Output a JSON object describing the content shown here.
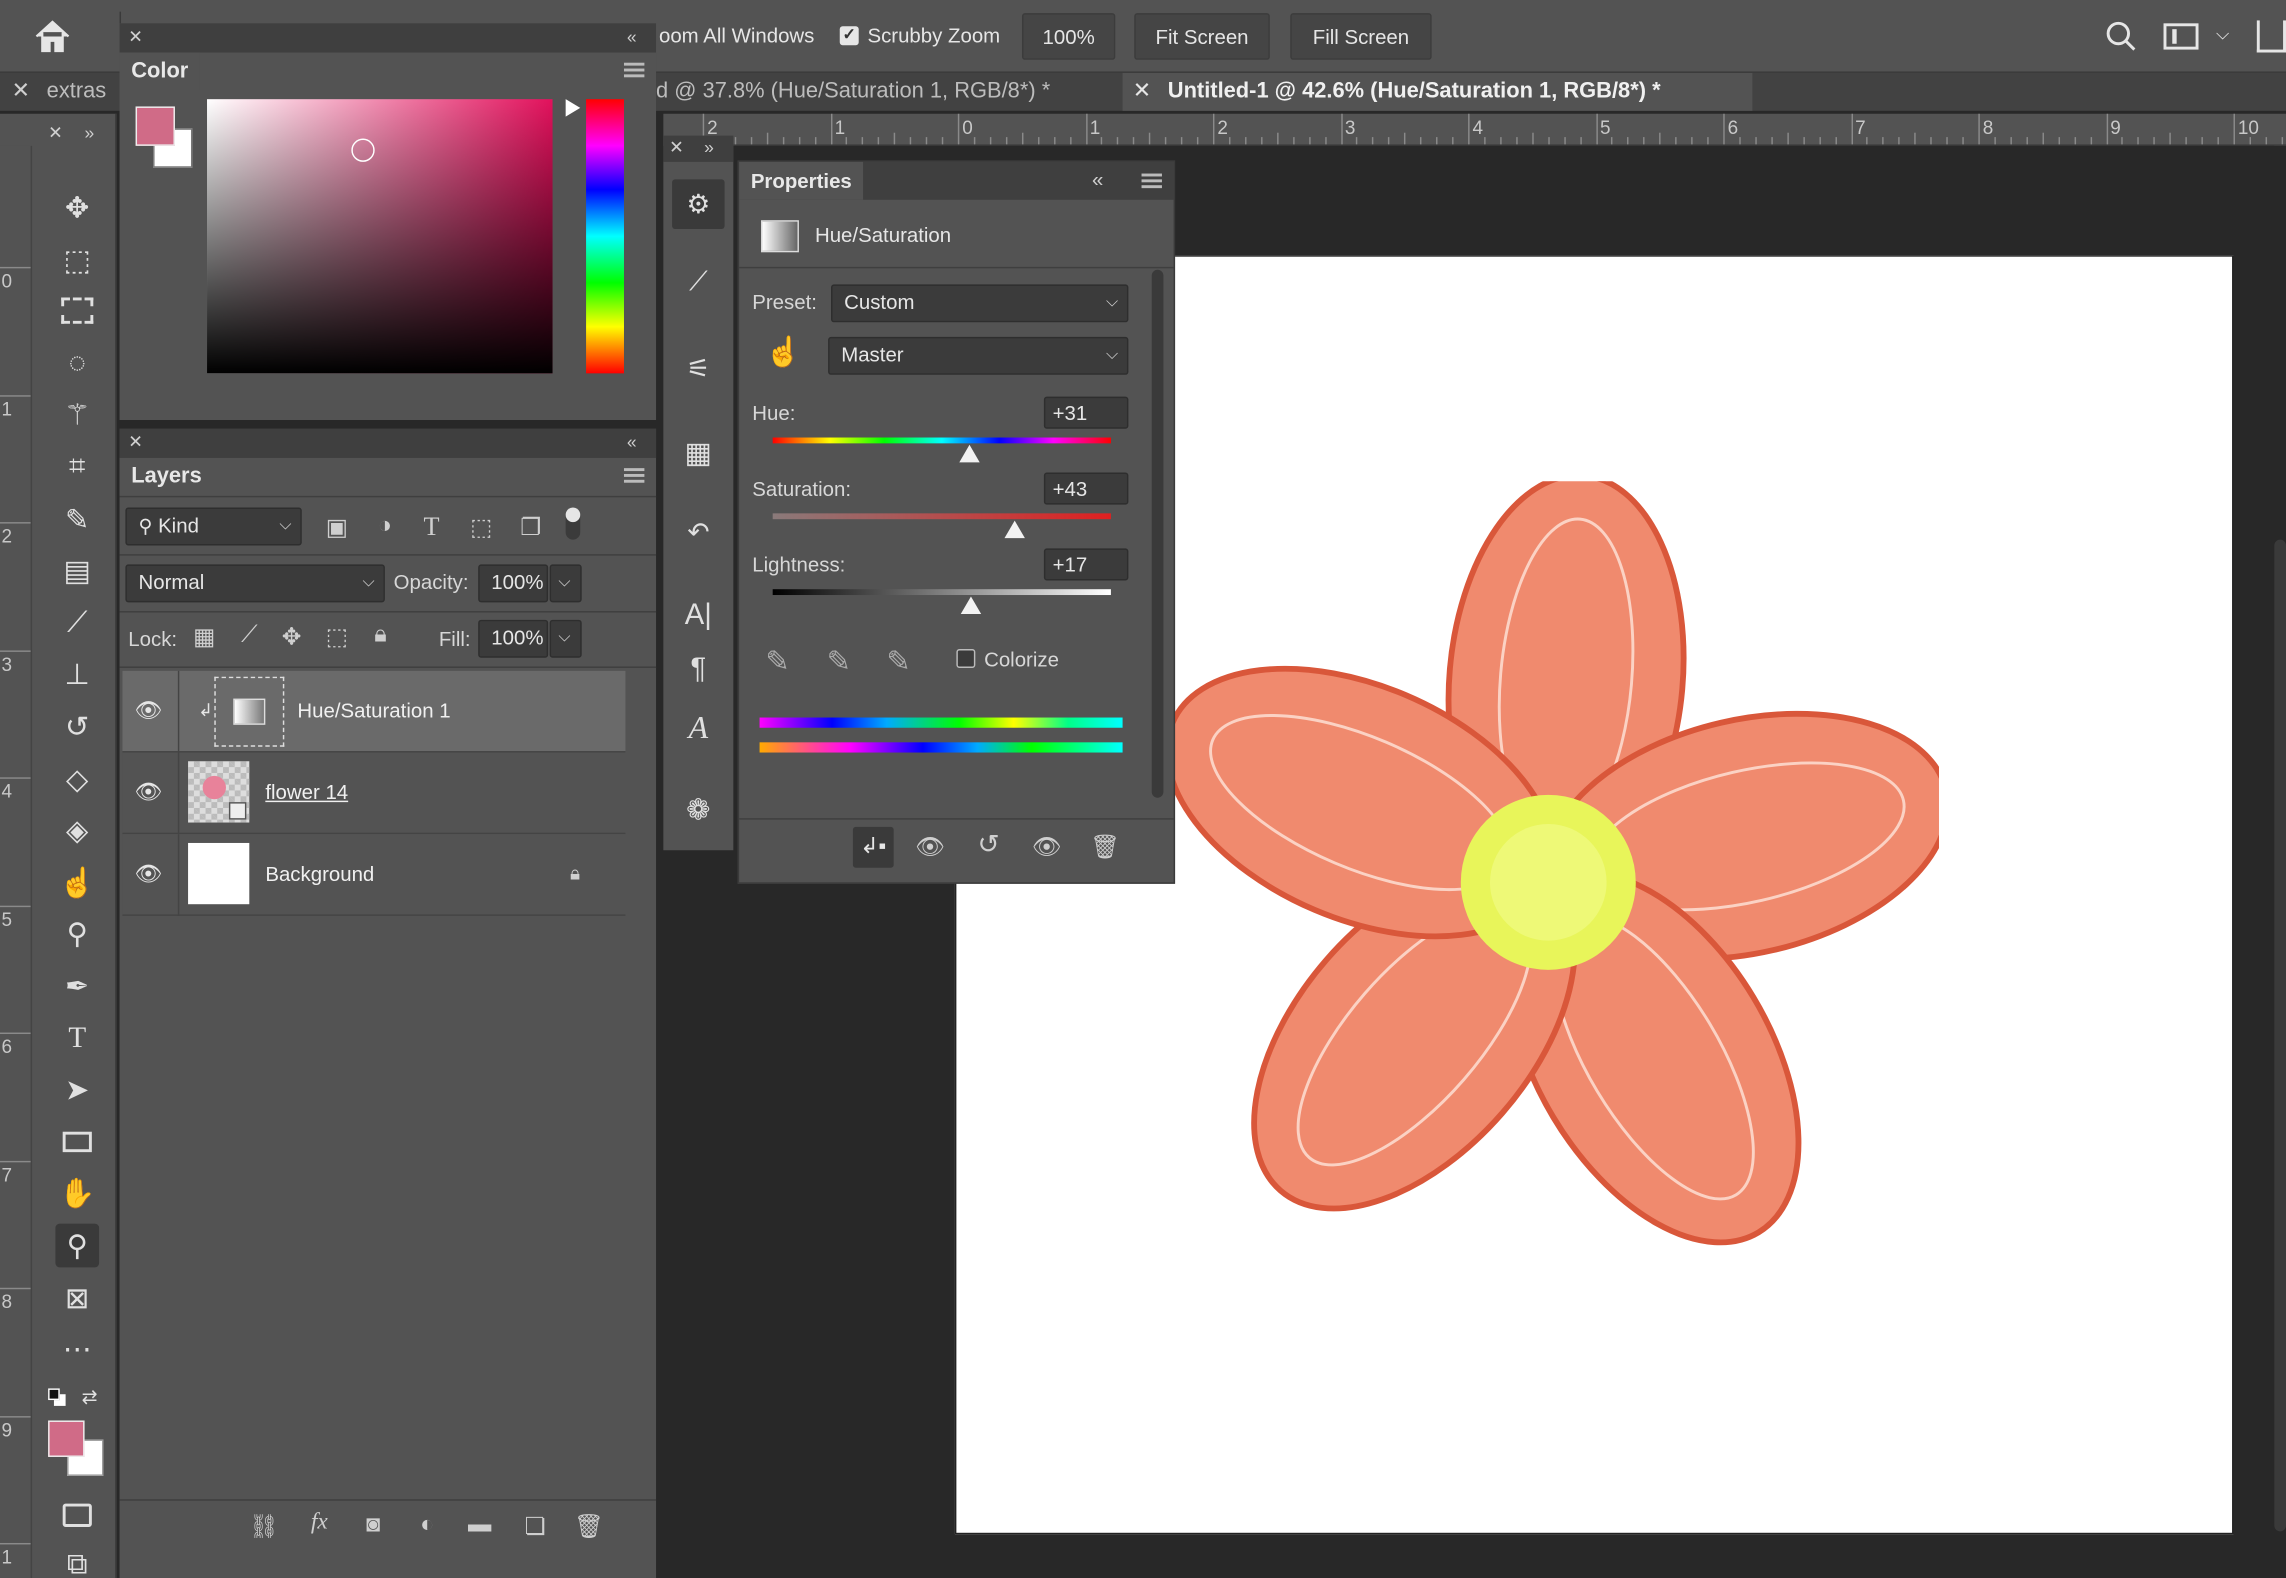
{
  "options_bar": {
    "zoom_all_windows": "oom All Windows",
    "scrubby_zoom": "Scrubby Zoom",
    "zoom_value": "100%",
    "fit_screen": "Fit Screen",
    "fill_screen": "Fill Screen"
  },
  "tabs": {
    "extras": "extras",
    "doc1": "d @ 37.8% (Hue/Saturation 1, RGB/8*) *",
    "doc2": "Untitled-1 @ 42.6% (Hue/Saturation 1, RGB/8*) *"
  },
  "ruler": {
    "top_numbers": [
      "2",
      "1",
      "0",
      "1",
      "2",
      "3",
      "4",
      "5",
      "6",
      "7",
      "8",
      "9",
      "10"
    ],
    "left_numbers": [
      "0",
      "1",
      "2",
      "3",
      "4",
      "5",
      "6",
      "7",
      "8",
      "9",
      "1"
    ]
  },
  "color_panel": {
    "title": "Color",
    "foreground": "#d06b87"
  },
  "layers_panel": {
    "title": "Layers",
    "filter_kind": "Kind",
    "blend_mode": "Normal",
    "opacity_label": "Opacity:",
    "opacity_value": "100%",
    "lock_label": "Lock:",
    "fill_label": "Fill:",
    "fill_value": "100%",
    "layers": [
      {
        "name": "Hue/Saturation 1"
      },
      {
        "name": "flower 14"
      },
      {
        "name": "Background"
      }
    ]
  },
  "properties_panel": {
    "title": "Properties",
    "adjustment_name": "Hue/Saturation",
    "preset_label": "Preset:",
    "preset_value": "Custom",
    "channel_value": "Master",
    "hue_label": "Hue:",
    "hue_value": "+31",
    "hue_level": 0.58,
    "saturation_label": "Saturation:",
    "saturation_value": "+43",
    "saturation_level": 0.715,
    "lightness_label": "Lightness:",
    "lightness_value": "+17",
    "lightness_level": 0.585,
    "colorize_label": "Colorize"
  },
  "colors": {
    "flower_petal": "#f08a6e",
    "flower_center": "#e8f55a"
  }
}
